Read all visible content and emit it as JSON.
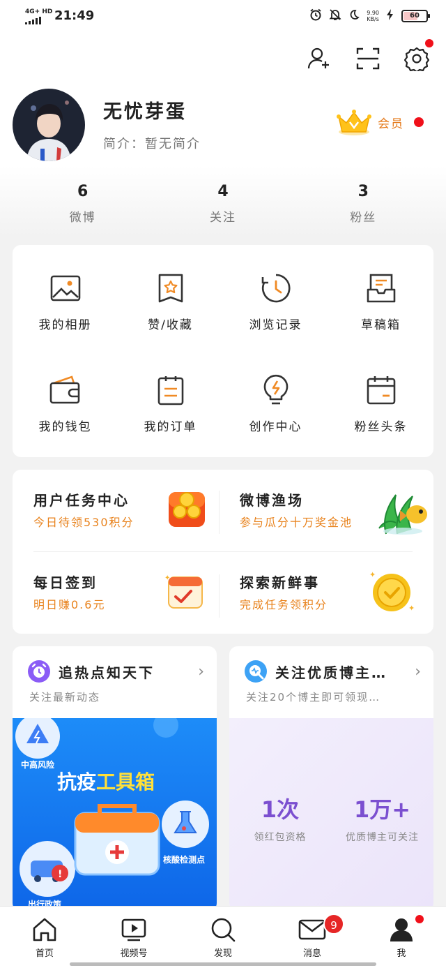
{
  "status_bar": {
    "network": "4G+ HD",
    "time": "21:49",
    "speed_value": "9.90",
    "speed_unit": "KB/s",
    "battery": "60"
  },
  "top_actions": {
    "icons": [
      "add-friend-icon",
      "scan-icon",
      "settings-icon"
    ],
    "settings_has_dot": true
  },
  "profile": {
    "username": "无忧芽蛋",
    "bio": "简介：暂无简介",
    "vip_label": "会员"
  },
  "stats": [
    {
      "value": "6",
      "label": "微博"
    },
    {
      "value": "4",
      "label": "关注"
    },
    {
      "value": "3",
      "label": "粉丝"
    }
  ],
  "grid": [
    {
      "label": "我的相册",
      "icon": "photo-album-icon"
    },
    {
      "label": "赞/收藏",
      "icon": "favorites-icon"
    },
    {
      "label": "浏览记录",
      "icon": "history-icon"
    },
    {
      "label": "草稿箱",
      "icon": "drafts-icon"
    },
    {
      "label": "我的钱包",
      "icon": "wallet-icon"
    },
    {
      "label": "我的订单",
      "icon": "orders-icon"
    },
    {
      "label": "创作中心",
      "icon": "creator-center-icon"
    },
    {
      "label": "粉丝头条",
      "icon": "fan-headline-icon"
    }
  ],
  "tasks": [
    {
      "title": "用户任务中心",
      "sub": "今日待领530积分"
    },
    {
      "title": "微博渔场",
      "sub": "参与瓜分十万奖金池"
    },
    {
      "title": "每日签到",
      "sub": "明日赚0.6元"
    },
    {
      "title": "探索新鲜事",
      "sub": "完成任务领积分"
    }
  ],
  "feature_left": {
    "title": "追热点知天下",
    "sub": "关注最新动态",
    "banner": {
      "risk": "中高风险",
      "headline_a": "抗疫",
      "headline_b": "工具箱",
      "test": "核酸检测点",
      "travel": "出行政策"
    }
  },
  "feature_right": {
    "title": "关注优质博主…",
    "sub": "关注20个博主即可领现…",
    "stat1_value": "1次",
    "stat1_label": "领红包资格",
    "stat2_value": "1万+",
    "stat2_label": "优质博主可关注"
  },
  "bottom_nav": [
    {
      "label": "首页",
      "icon": "home-icon"
    },
    {
      "label": "视频号",
      "icon": "video-icon"
    },
    {
      "label": "发现",
      "icon": "discover-icon"
    },
    {
      "label": "消息",
      "icon": "message-icon",
      "badge": "9"
    },
    {
      "label": "我",
      "icon": "profile-icon"
    }
  ],
  "colors": {
    "accent_orange": "#e8821c",
    "red_dot": "#f0101a",
    "purple": "#7b4fd0"
  }
}
